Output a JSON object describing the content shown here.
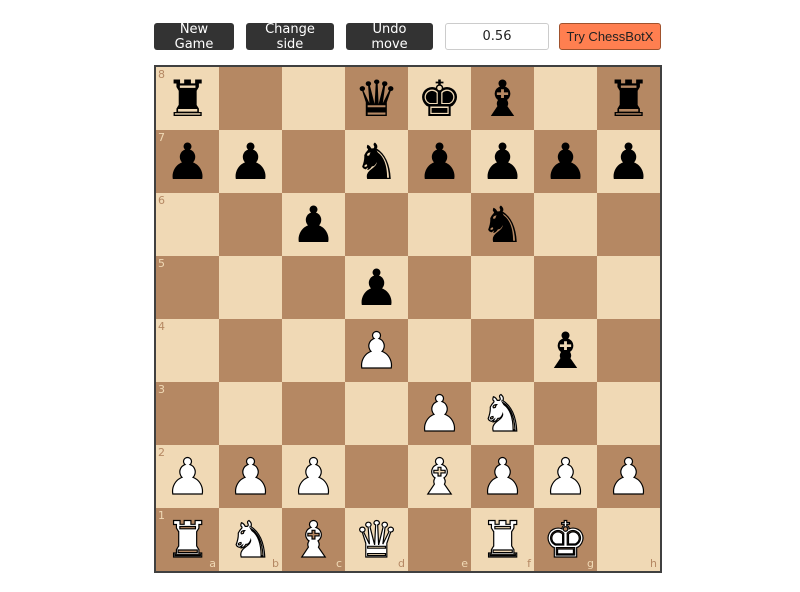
{
  "toolbar": {
    "new_game": "New Game",
    "change_side": "Change side",
    "undo_move": "Undo move",
    "evaluation": "0.56",
    "try_bot": "Try ChessBotX"
  },
  "colors": {
    "light_square": "#f0d9b5",
    "dark_square": "#b58863",
    "button_bg": "#333333",
    "accent_button": "#ff7f50"
  },
  "board": {
    "files": [
      "a",
      "b",
      "c",
      "d",
      "e",
      "f",
      "g",
      "h"
    ],
    "ranks": [
      "8",
      "7",
      "6",
      "5",
      "4",
      "3",
      "2",
      "1"
    ],
    "position": {
      "a8": "bR",
      "d8": "bQ",
      "e8": "bK",
      "f8": "bB",
      "h8": "bR",
      "a7": "bP",
      "b7": "bP",
      "d7": "bN",
      "e7": "bP",
      "f7": "bP",
      "g7": "bP",
      "h7": "bP",
      "c6": "bP",
      "f6": "bN",
      "d5": "bP",
      "d4": "wP",
      "g4": "bB",
      "e3": "wP",
      "f3": "wN",
      "a2": "wP",
      "b2": "wP",
      "c2": "wP",
      "e2": "wB",
      "f2": "wP",
      "g2": "wP",
      "h2": "wP",
      "a1": "wR",
      "b1": "wN",
      "c1": "wB",
      "d1": "wQ",
      "f1": "wR",
      "g1": "wK"
    }
  }
}
